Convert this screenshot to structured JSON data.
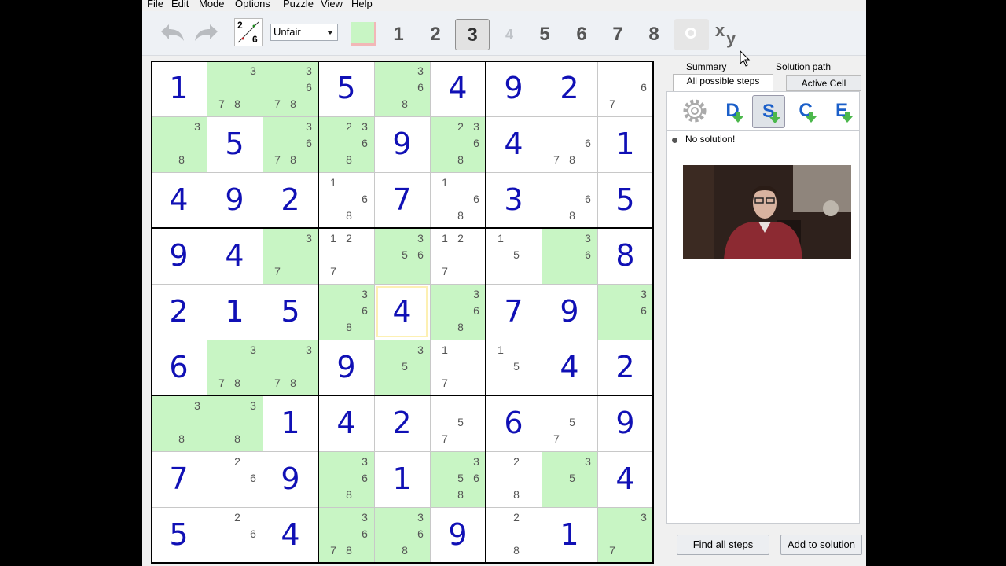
{
  "menu": [
    "File",
    "Edit",
    "Mode",
    "Options",
    "Puzzle",
    "View",
    "Help"
  ],
  "toolbar": {
    "undo_icon": "undo-icon",
    "redo_icon": "redo-icon",
    "difficulty_icon": {
      "top_left": "2",
      "bottom_right": "6"
    },
    "level": "Unfair",
    "filter_color": "#c8f5c4",
    "digits": [
      "1",
      "2",
      "3",
      "4",
      "5",
      "6",
      "7",
      "8"
    ],
    "selected_digit": "3",
    "disabled_digit": "4",
    "xy_label_x": "x",
    "xy_label_y": "y"
  },
  "grid": {
    "rows": [
      [
        {
          "v": "1"
        },
        {
          "c": [
            "3",
            "7",
            "8"
          ],
          "g": 1
        },
        {
          "c": [
            "3",
            "6",
            "7",
            "8"
          ],
          "g": 1
        },
        {
          "v": "5"
        },
        {
          "c": [
            "3",
            "6",
            "8"
          ],
          "g": 1
        },
        {
          "v": "4"
        },
        {
          "v": "9"
        },
        {
          "v": "2"
        },
        {
          "c": [
            "6",
            "7"
          ]
        }
      ],
      [
        {
          "c": [
            "3",
            "8"
          ],
          "g": 1
        },
        {
          "v": "5"
        },
        {
          "c": [
            "3",
            "6",
            "7",
            "8"
          ],
          "g": 1
        },
        {
          "c": [
            "2",
            "3",
            "6",
            "8"
          ],
          "g": 1
        },
        {
          "v": "9"
        },
        {
          "c": [
            "2",
            "3",
            "6",
            "8"
          ],
          "g": 1
        },
        {
          "v": "4"
        },
        {
          "c": [
            "6",
            "7",
            "8"
          ]
        },
        {
          "v": "1"
        }
      ],
      [
        {
          "v": "4"
        },
        {
          "v": "9"
        },
        {
          "v": "2"
        },
        {
          "c": [
            "1",
            "6",
            "8"
          ]
        },
        {
          "v": "7"
        },
        {
          "c": [
            "1",
            "6",
            "8"
          ]
        },
        {
          "v": "3"
        },
        {
          "c": [
            "6",
            "8"
          ]
        },
        {
          "v": "5"
        }
      ],
      [
        {
          "v": "9"
        },
        {
          "v": "4"
        },
        {
          "c": [
            "3",
            "7"
          ],
          "g": 1
        },
        {
          "c": [
            "1",
            "2",
            "7"
          ]
        },
        {
          "c": [
            "3",
            "5",
            "6"
          ],
          "g": 1
        },
        {
          "c": [
            "1",
            "2",
            "7"
          ]
        },
        {
          "c": [
            "1",
            "5"
          ]
        },
        {
          "c": [
            "3",
            "6"
          ],
          "g": 1
        },
        {
          "v": "8"
        }
      ],
      [
        {
          "v": "2"
        },
        {
          "v": "1"
        },
        {
          "v": "5"
        },
        {
          "c": [
            "3",
            "6",
            "8"
          ],
          "g": 1
        },
        {
          "v": "4",
          "a": 1
        },
        {
          "c": [
            "3",
            "6",
            "8"
          ],
          "g": 1
        },
        {
          "v": "7"
        },
        {
          "v": "9"
        },
        {
          "c": [
            "3",
            "6"
          ],
          "g": 1
        }
      ],
      [
        {
          "v": "6"
        },
        {
          "c": [
            "3",
            "7",
            "8"
          ],
          "g": 1
        },
        {
          "c": [
            "3",
            "7",
            "8"
          ],
          "g": 1
        },
        {
          "v": "9"
        },
        {
          "c": [
            "3",
            "5"
          ],
          "g": 1
        },
        {
          "c": [
            "1",
            "7"
          ]
        },
        {
          "c": [
            "1",
            "5"
          ]
        },
        {
          "v": "4"
        },
        {
          "v": "2"
        }
      ],
      [
        {
          "c": [
            "3",
            "8"
          ],
          "g": 1
        },
        {
          "c": [
            "3",
            "8"
          ],
          "g": 1
        },
        {
          "v": "1"
        },
        {
          "v": "4"
        },
        {
          "v": "2"
        },
        {
          "c": [
            "5",
            "7"
          ]
        },
        {
          "v": "6"
        },
        {
          "c": [
            "5",
            "7"
          ]
        },
        {
          "v": "9"
        }
      ],
      [
        {
          "v": "7"
        },
        {
          "c": [
            "2",
            "6"
          ]
        },
        {
          "v": "9"
        },
        {
          "c": [
            "3",
            "6",
            "8"
          ],
          "g": 1
        },
        {
          "v": "1"
        },
        {
          "c": [
            "3",
            "5",
            "6",
            "8"
          ],
          "g": 1
        },
        {
          "c": [
            "2",
            "8"
          ]
        },
        {
          "c": [
            "3",
            "5"
          ],
          "g": 1
        },
        {
          "v": "4"
        }
      ],
      [
        {
          "v": "5"
        },
        {
          "c": [
            "2",
            "6"
          ]
        },
        {
          "v": "4"
        },
        {
          "c": [
            "3",
            "6",
            "7",
            "8"
          ],
          "g": 1
        },
        {
          "c": [
            "3",
            "6",
            "8"
          ],
          "g": 1
        },
        {
          "v": "9"
        },
        {
          "c": [
            "2",
            "8"
          ]
        },
        {
          "v": "1"
        },
        {
          "c": [
            "3",
            "7"
          ],
          "g": 1
        }
      ]
    ]
  },
  "panel": {
    "tabs": {
      "summary": "Summary",
      "solution_path": "Solution path",
      "all_steps": "All possible steps",
      "active_cell": "Active Cell"
    },
    "step_buttons": [
      {
        "icon": "gear-icon",
        "label": ""
      },
      {
        "icon": "d-arrow-icon",
        "label": "D"
      },
      {
        "icon": "s-arrow-icon",
        "label": "S"
      },
      {
        "icon": "c-arrow-icon",
        "label": "C"
      },
      {
        "icon": "e-arrow-icon",
        "label": "E"
      }
    ],
    "status": "No solution!",
    "find_all": "Find all steps",
    "add_solution": "Add to solution"
  }
}
